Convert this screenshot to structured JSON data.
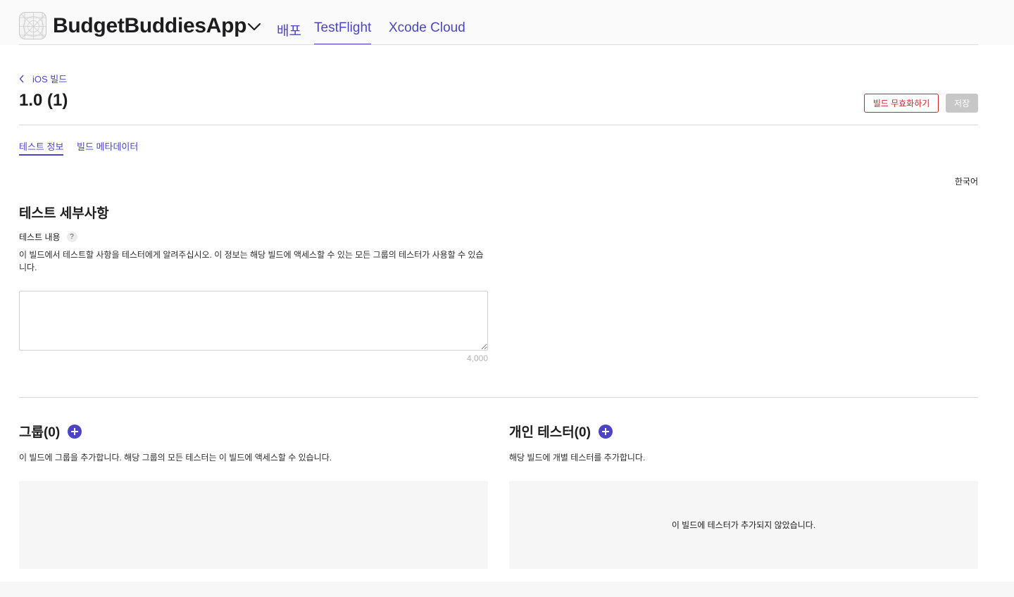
{
  "header": {
    "app_name": "BudgetBuddiesApp",
    "tabs": [
      {
        "label": "배포",
        "active": false
      },
      {
        "label": "TestFlight",
        "active": true
      },
      {
        "label": "Xcode Cloud",
        "active": false
      }
    ]
  },
  "breadcrumb": {
    "back_label": "iOS 빌드"
  },
  "build": {
    "title": "1.0 (1)"
  },
  "actions": {
    "expire_label": "빌드 무효화하기",
    "save_label": "저장"
  },
  "subtabs": [
    {
      "label": "테스트 정보",
      "active": true
    },
    {
      "label": "빌드 메타데이터",
      "active": false
    }
  ],
  "language": "한국어",
  "test_details": {
    "title": "테스트 세부사항",
    "field_label": "테스트 내용",
    "help_glyph": "?",
    "description": "이 빌드에서 테스트할 사항을 테스터에게 알려주십시오. 이 정보는 해당 빌드에 액세스할 수 있는 모든 그룹의 테스터가 사용할 수 있습니다.",
    "value": "",
    "char_limit": "4,000"
  },
  "groups": {
    "title": "그룹(0)",
    "description": "이 빌드에 그룹을 추가합니다. 해당 그룹의 모든 테스터는 이 빌드에 액세스할 수 있습니다.",
    "empty_text": ""
  },
  "individual_testers": {
    "title": "개인 테스터(0)",
    "description": "해당 빌드에 개별 테스터를 추가합니다.",
    "empty_text": "이 빌드에 테스터가 추가되지 않았습니다."
  },
  "colors": {
    "accent": "#4b45c6",
    "danger": "#c9242c",
    "disabled": "#c7c7c7"
  }
}
